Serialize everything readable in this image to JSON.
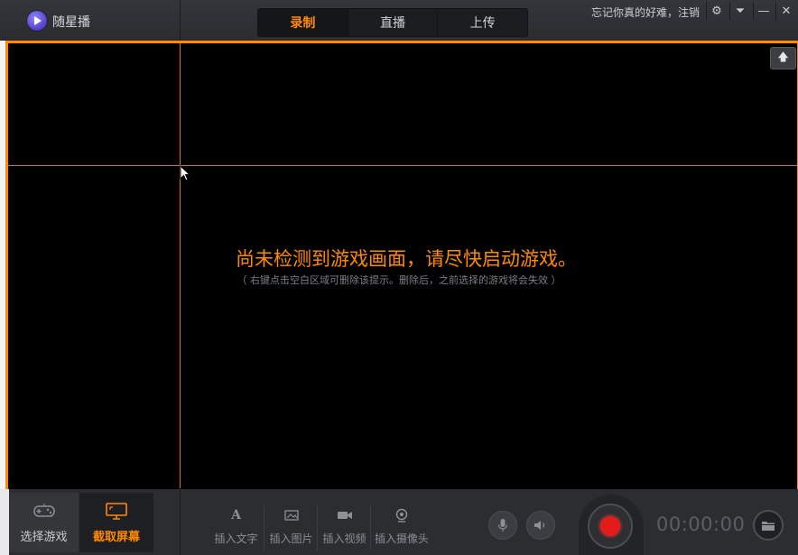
{
  "app": {
    "name": "随星播"
  },
  "tabs": [
    {
      "label": "录制",
      "active": true
    },
    {
      "label": "直播",
      "active": false
    },
    {
      "label": "上传",
      "active": false
    }
  ],
  "account": {
    "text": "忘记你真的好难，注销"
  },
  "window_controls": [
    "gear-icon",
    "dropdown-icon",
    "minimize-icon",
    "close-icon"
  ],
  "preview": {
    "message": "尚未检测到游戏画面，请尽快启动游戏。",
    "hint": "（ 右键点击空白区域可删除该提示。删除后，之前选择的游戏将会失效 ）"
  },
  "modes": [
    {
      "label": "选择游戏",
      "icon": "gamepad-icon",
      "active": false
    },
    {
      "label": "截取屏幕",
      "icon": "monitor-icon",
      "active": true
    }
  ],
  "inserts": [
    {
      "label": "插入文字",
      "icon": "text-icon"
    },
    {
      "label": "插入图片",
      "icon": "image-icon"
    },
    {
      "label": "插入视频",
      "icon": "video-icon"
    },
    {
      "label": "插入摄像头",
      "icon": "webcam-icon"
    }
  ],
  "audio": [
    "microphone-icon",
    "speaker-icon"
  ],
  "record": {
    "timer": "00:00:00"
  },
  "colors": {
    "accent": "#ff8a00",
    "record": "#e31b1b",
    "background": "#2a2c30"
  }
}
